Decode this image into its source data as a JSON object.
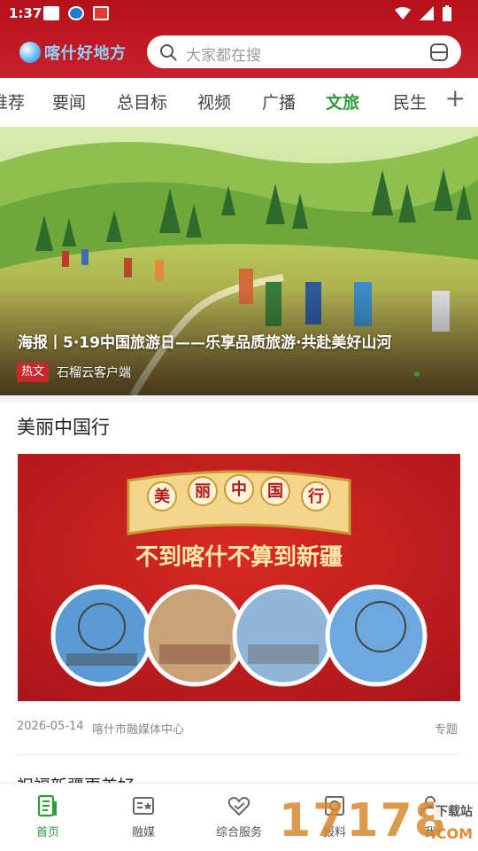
{
  "status_bar": {
    "time": "1:37"
  },
  "app": {
    "logo_text": "喀什好地方"
  },
  "search": {
    "placeholder": "大家都在搜"
  },
  "tabs": [
    {
      "label": "推荐"
    },
    {
      "label": "要闻"
    },
    {
      "label": "总目标"
    },
    {
      "label": "视频"
    },
    {
      "label": "广播"
    },
    {
      "label": "文旅"
    },
    {
      "label": "民生"
    }
  ],
  "tabs_add": "+",
  "hero": {
    "title": "海报丨5·19中国旅游日——乐享品质旅游·共赴美好山河",
    "tag": "热文",
    "source": "石榴云客户端"
  },
  "section": {
    "title": "美丽中国行",
    "banner": {
      "chars": [
        "美",
        "丽",
        "中",
        "国",
        "行"
      ],
      "slogan": "不到喀什不算到新疆"
    },
    "date": "2026-05-14",
    "source": "喀什市融媒体中心",
    "tag": "专题"
  },
  "next_title": "祝福新疆更美好",
  "bottom_nav": [
    {
      "label": "首页"
    },
    {
      "label": "融媒"
    },
    {
      "label": "综合服务"
    },
    {
      "label": "报料"
    },
    {
      "label": "我"
    }
  ],
  "watermark": {
    "number": "17178",
    "download": "下载站",
    "suffix": ".COM"
  },
  "colors": {
    "brand_red": "#c9202a",
    "active_green": "#2f9b3c"
  }
}
